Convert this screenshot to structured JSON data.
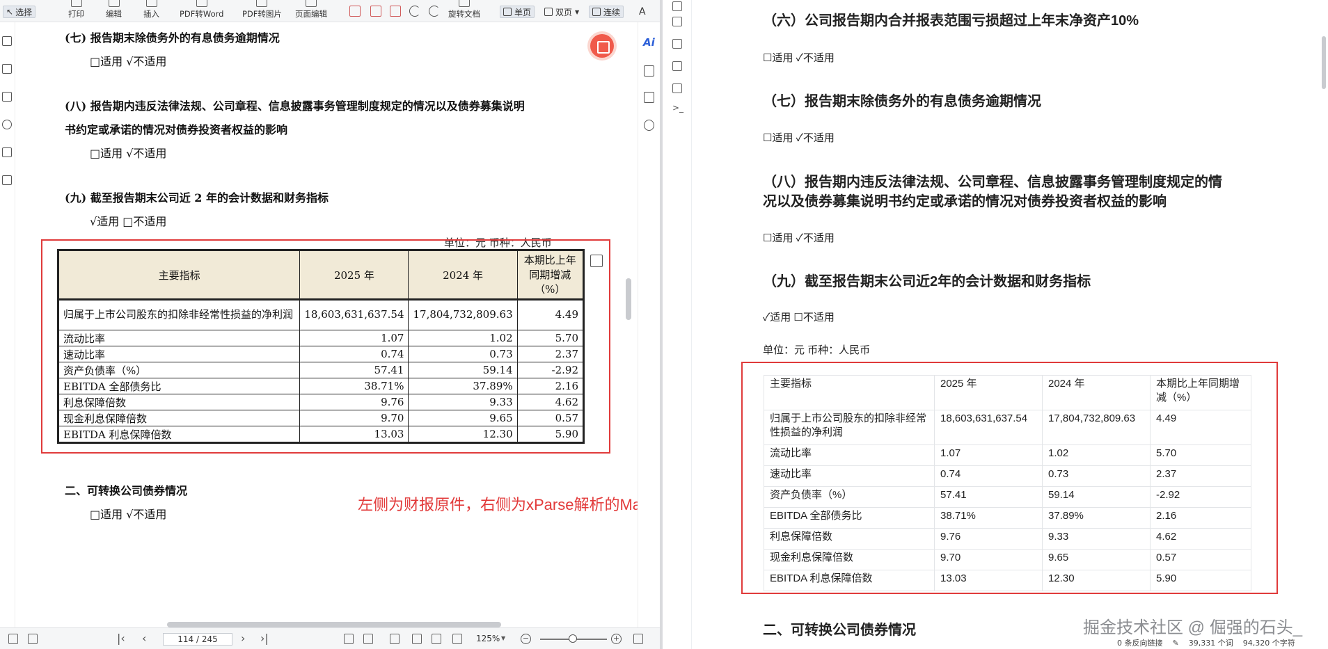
{
  "toolbar": {
    "select": "选择",
    "print": "打印",
    "edit": "编辑",
    "insert": "插入",
    "pdf_to_word": "PDF转Word",
    "pdf_to_image": "PDF转图片",
    "page_edit": "页面编辑",
    "rotate": "旋转文档",
    "single_page": "单页",
    "double_page": "双页",
    "continuous": "连续"
  },
  "pdf": {
    "s7_title": "(七) 报告期末除债务外的有息债务逾期情况",
    "s7_status": "□适用 √不适用",
    "s8_title_line1": "(八)  报告期内违反法律法规、公司章程、信息披露事务管理制度规定的情况以及债券募集说明",
    "s8_title_line2": "书约定或承诺的情况对债券投资者权益的影响",
    "s8_status": "□适用 √不适用",
    "s9_title": "(九) 截至报告期末公司近 2 年的会计数据和财务指标",
    "s9_status": "√适用 □不适用",
    "unit": "单位：元  币种：人民币",
    "table": {
      "headers": [
        "主要指标",
        "2025 年",
        "2024 年",
        "本期比上年同期增减（%）"
      ],
      "rows": [
        [
          "归属于上市公司股东的扣除非经常性损益的净利润",
          "18,603,631,637.54",
          "17,804,732,809.63",
          "4.49"
        ],
        [
          "流动比率",
          "1.07",
          "1.02",
          "5.70"
        ],
        [
          "速动比率",
          "0.74",
          "0.73",
          "2.37"
        ],
        [
          "资产负债率（%）",
          "57.41",
          "59.14",
          "-2.92"
        ],
        [
          "EBITDA 全部债务比",
          "38.71%",
          "37.89%",
          "2.16"
        ],
        [
          "利息保障倍数",
          "9.76",
          "9.33",
          "4.62"
        ],
        [
          "现金利息保障倍数",
          "9.70",
          "9.65",
          "0.57"
        ],
        [
          "EBITDA 利息保障倍数",
          "13.03",
          "12.30",
          "5.90"
        ]
      ]
    },
    "s2_title": "二、可转换公司债券情况",
    "s2_status": "□适用 √不适用"
  },
  "caption": "左侧为财报原件，右侧为xParse解析的Markdown",
  "ai_label": "Ai",
  "status": {
    "page": "114 / 245",
    "zoom": "125%"
  },
  "md": {
    "s6_title": "（六）公司报告期内合并报表范围亏损超过上年末净资产10%",
    "s6_status": "☐适用 ✓不适用",
    "s7_title": "（七）报告期末除债务外的有息债务逾期情况",
    "s7_status": "☐适用 ✓不适用",
    "s8_title_line1": "（八）报告期内违反法律法规、公司章程、信息披露事务管理制度规定的情",
    "s8_title_line2": "况以及债券募集说明书约定或承诺的情况对债券投资者权益的影响",
    "s8_status": "☐适用 ✓不适用",
    "s9_title": "（九）截至报告期末公司近2年的会计数据和财务指标",
    "s9_status": "✓适用 ☐不适用",
    "unit": "单位：元 币种：人民币",
    "table": {
      "headers": [
        "主要指标",
        "2025 年",
        "2024 年",
        "本期比上年同期增减（%）"
      ],
      "rows": [
        [
          "归属于上市公司股东的扣除非经常性损益的净利润",
          "18,603,631,637.54",
          "17,804,732,809.63",
          "4.49"
        ],
        [
          "流动比率",
          "1.07",
          "1.02",
          "5.70"
        ],
        [
          "速动比率",
          "0.74",
          "0.73",
          "2.37"
        ],
        [
          "资产负债率（%）",
          "57.41",
          "59.14",
          "-2.92"
        ],
        [
          "EBITDA 全部债务比",
          "38.71%",
          "37.89%",
          "2.16"
        ],
        [
          "利息保障倍数",
          "9.76",
          "9.33",
          "4.62"
        ],
        [
          "现金利息保障倍数",
          "9.70",
          "9.65",
          "0.57"
        ],
        [
          "EBITDA 利息保障倍数",
          "13.03",
          "12.30",
          "5.90"
        ]
      ]
    },
    "s2_title": "二、可转换公司债券情况"
  },
  "watermark": "掘金技术社区 @ 倔强的石头_",
  "right_status": {
    "backlinks": "0 条反向链接",
    "words": "39,331 个词",
    "chars": "94,320 个字符"
  },
  "colors": {
    "highlight": "#e03b3b",
    "caption": "#e23a3a",
    "ai": "#2c5fd8"
  }
}
